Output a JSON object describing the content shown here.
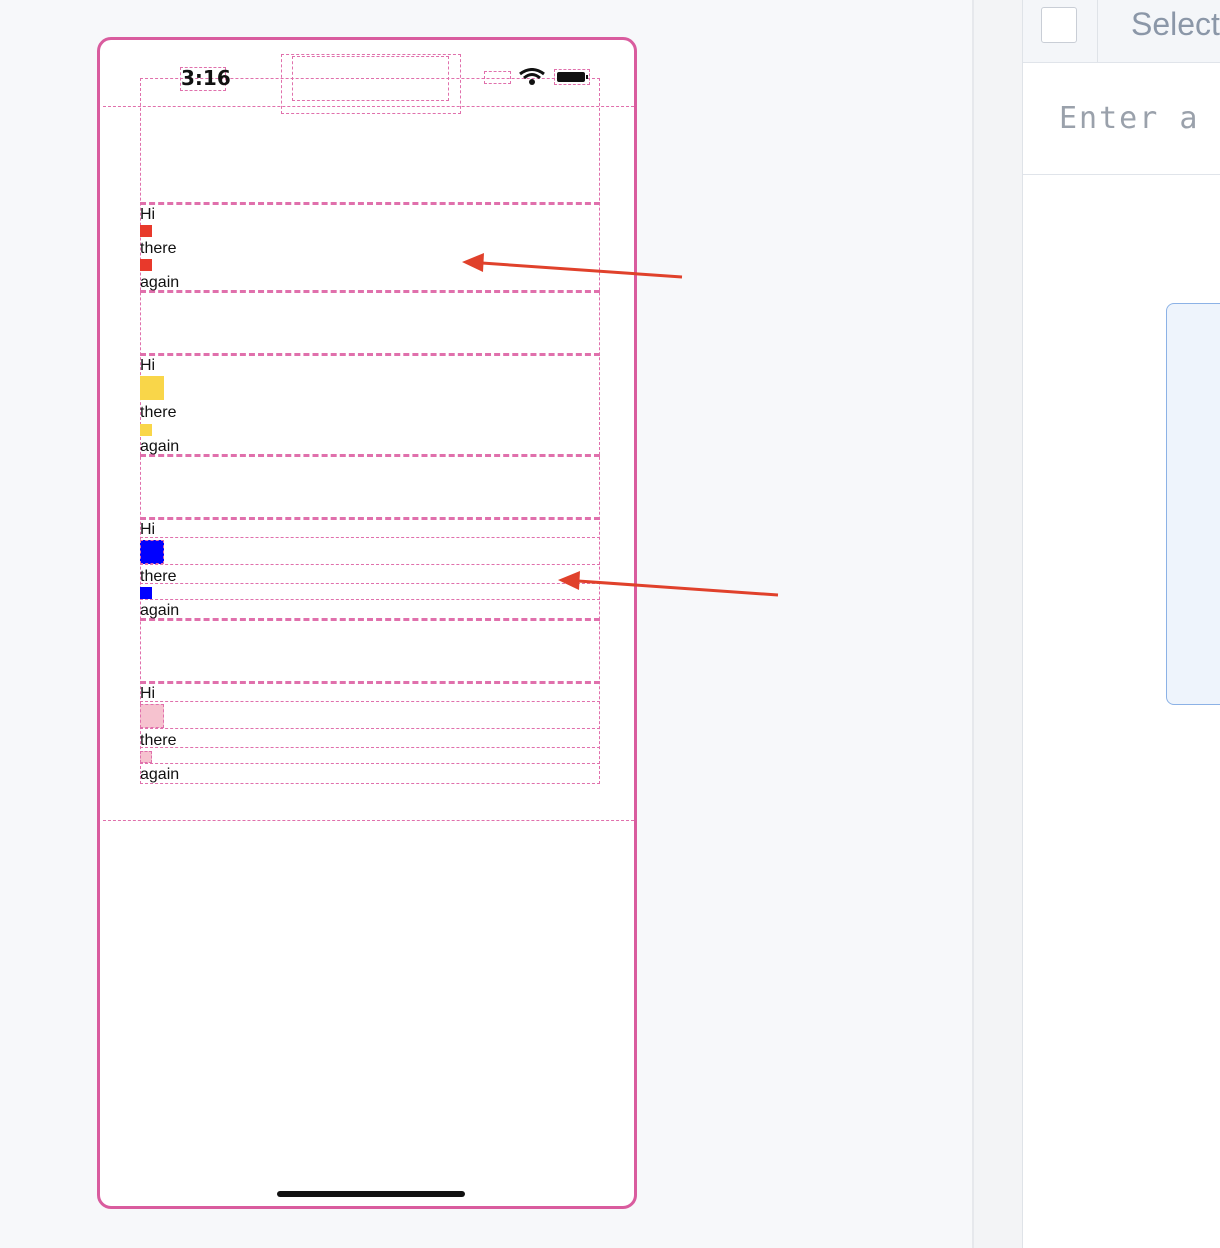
{
  "status_bar": {
    "time": "3:16"
  },
  "groups": [
    {
      "labels": [
        "Hi",
        "there",
        "again"
      ],
      "color": "#e8392b"
    },
    {
      "labels": [
        "Hi",
        "there",
        "again"
      ],
      "color": "#f9d649"
    },
    {
      "labels": [
        "Hi",
        "there",
        "again"
      ],
      "color": "#0000ff"
    },
    {
      "labels": [
        "Hi",
        "there",
        "again"
      ],
      "color": "#f6c2cf"
    }
  ],
  "annotation_color": "#e0412b",
  "editor": {
    "select_label": "Select",
    "input_placeholder": "Enter a c"
  }
}
